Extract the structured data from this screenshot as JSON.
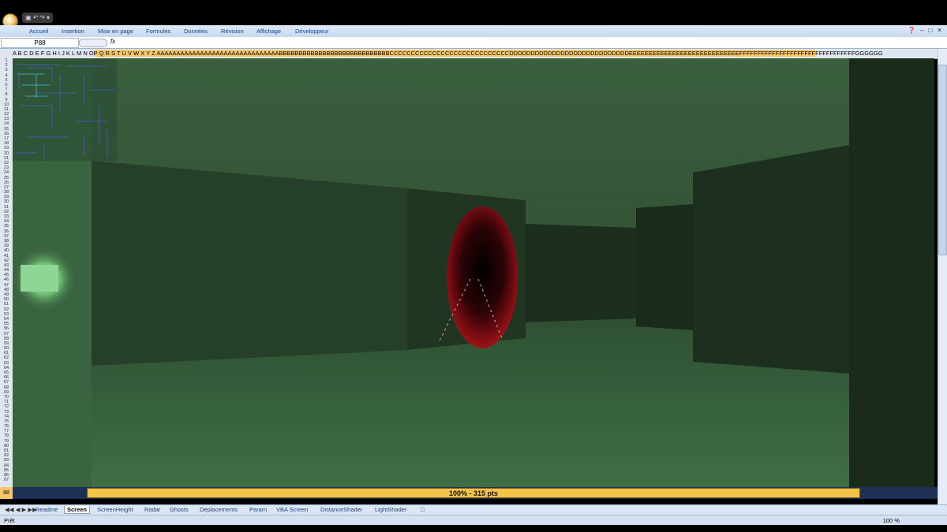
{
  "quick_access": {
    "save": "▣",
    "undo": "↶",
    "redo": "↷",
    "menu": "▾"
  },
  "ribbon": {
    "tabs": [
      "Accueil",
      "Insertion",
      "Mise en page",
      "Formules",
      "Données",
      "Révision",
      "Affichage",
      "Développeur"
    ],
    "help": "❓",
    "minimize": "–",
    "restore": "□",
    "close": "✕"
  },
  "formula_bar": {
    "name_box": "P88",
    "fx_label": "fx",
    "formula": ""
  },
  "column_headers": {
    "left_normal": "A B C D E F G H I J K L M N O",
    "highlighted": "P Q R S T U V W X Y Z AAAAAAAAAAAAAAAAAAAAAAAAAAAAAAABBBBBBBBBBBBBBBBBBBBBBBBBBBBCCCCCCCCCCCCCCCCCCCCCCCCCCCCDDDDDDDDDDDDDDDDDDDDDDDDDDDDEEEEEEEEEEEEEEEEEEEEEEEEEEEEFFFFFFFFFFFFFFFFFFFFF",
    "right_normal": "FFFFFFFFFFFGGGGGG"
  },
  "rows_count": 87,
  "status_row": {
    "row_number": "88",
    "text": "100%   -   315 pts",
    "progress": 1.0
  },
  "sheet_tabs": [
    "Readme",
    "Screen",
    "ScreenHeight",
    "Radar",
    "Ghosts",
    "Deplacements",
    "Param",
    "VBA Screen",
    "DistanceShader",
    "LightShader"
  ],
  "active_sheet": "Screen",
  "status_bar": {
    "ready": "Prêt",
    "zoom": "100 %"
  },
  "colors": {
    "wall_dark": "#1f3521",
    "floor": "#3e6b43",
    "ceiling": "#2f5233",
    "ghost_red": "#8a0d12",
    "light_green": "#8fd694",
    "minimap_wall": "#3b5ba8"
  }
}
